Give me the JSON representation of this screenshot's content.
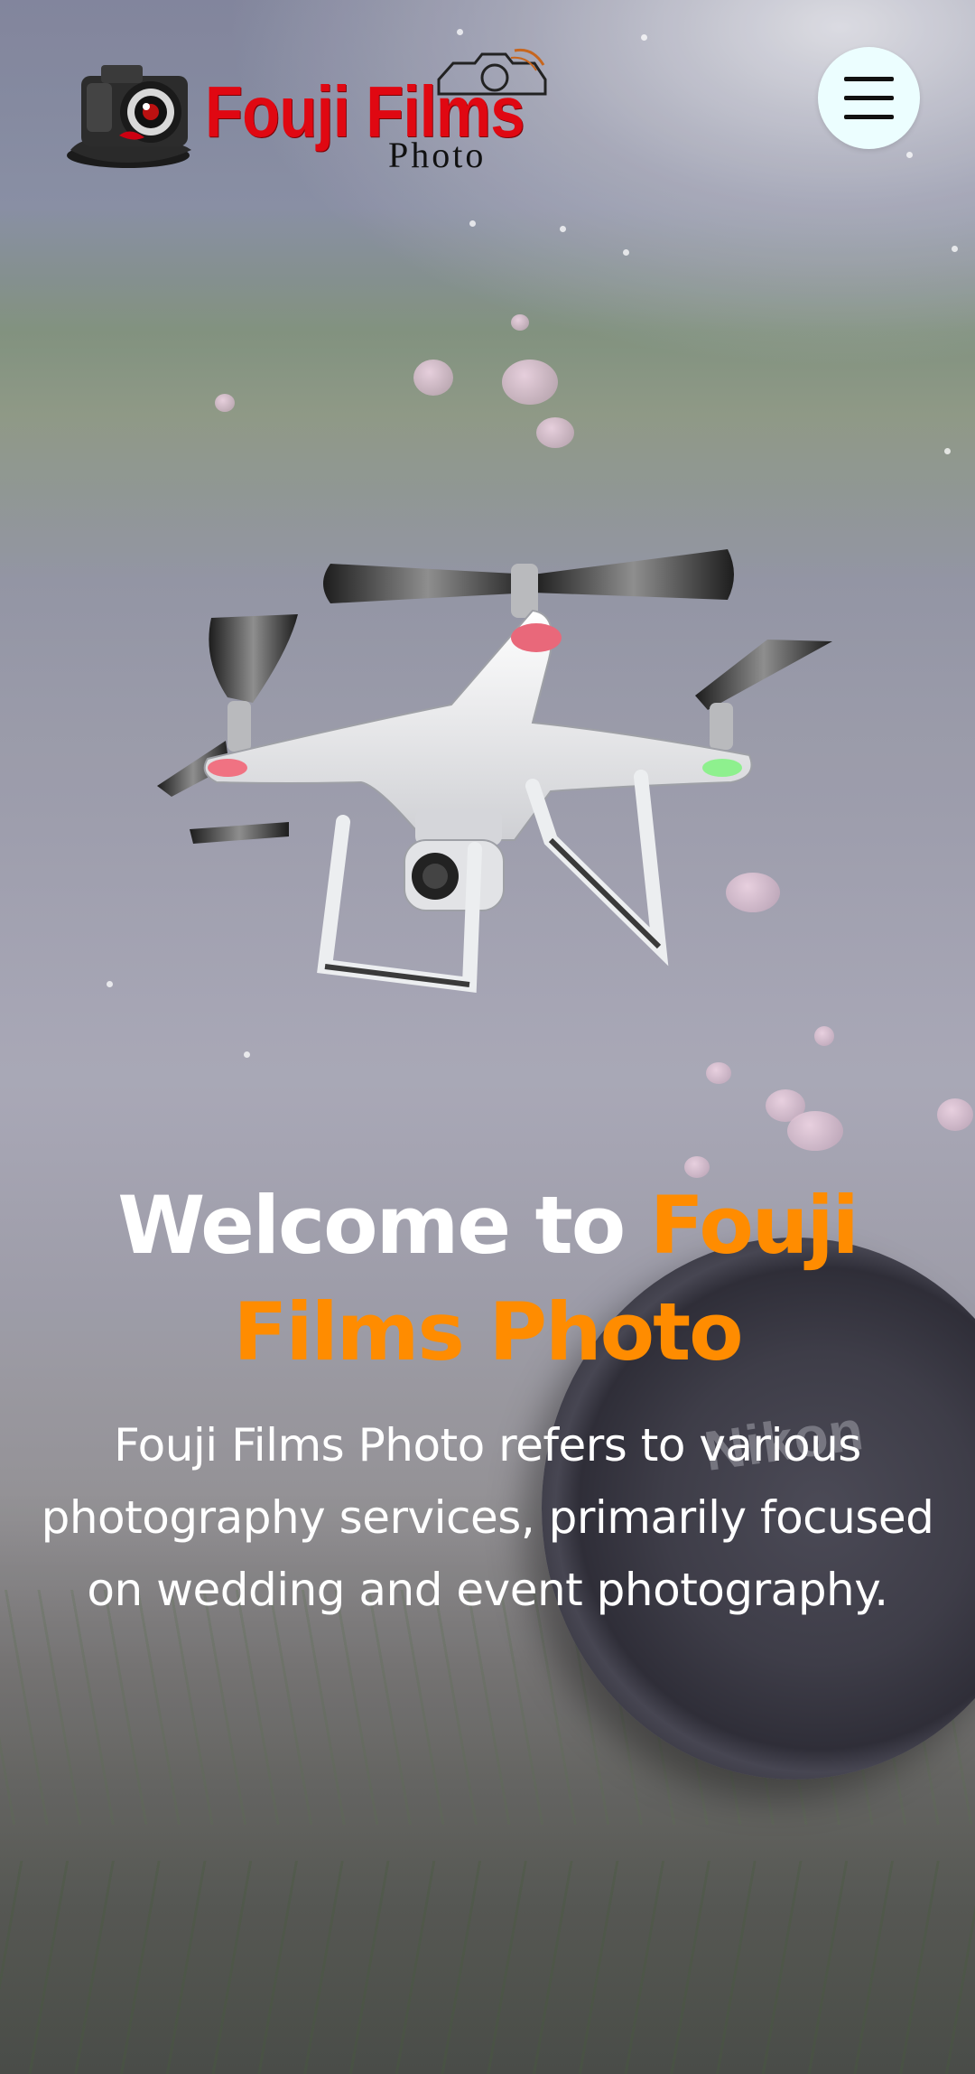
{
  "header": {
    "logo": {
      "title": "Fouji Films",
      "subtitle": "Photo"
    },
    "menu_button": {
      "icon": "hamburger-menu-icon",
      "background": "#ecfeff"
    }
  },
  "hero": {
    "heading_white": "Welcome to ",
    "heading_accent": "Fouji Films Photo",
    "description": "Fouji Films Photo refers to various photography services, primarily focused on wedding and event photography.",
    "lens_cap_text": "Nikon",
    "colors": {
      "accent": "#ff8c00",
      "heading": "#ffffff",
      "logo_red": "#e00812"
    }
  }
}
